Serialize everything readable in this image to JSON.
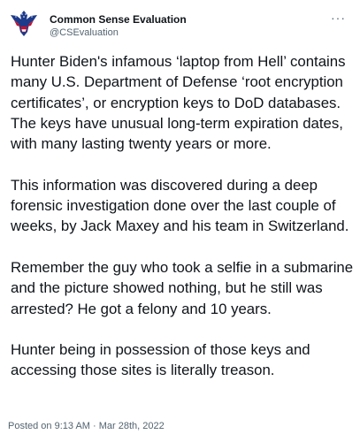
{
  "account": {
    "name": "Common Sense Evaluation",
    "handle": "@CSEvaluation",
    "avatar_icon": "eagle-flag-logo-icon",
    "more_label": "···"
  },
  "tweet": {
    "paragraphs": [
      "Hunter Biden's infamous ‘laptop from Hell’ contains\nmany U.S. Department of Defense ‘root encryption\ncertificates’, or encryption keys to DoD databases.\nThe keys have unusual long-term expiration dates,\nwith many lasting twenty years or more.",
      "This information was discovered during a deep\nforensic investigation done over the last couple of\nweeks, by Jack Maxey and his team in Switzerland.",
      "Remember the guy who took a selfie in a submarine\nand the picture showed nothing, but he still was\narrested? He got a felony and 10 years.",
      "Hunter being in possession of those keys and\naccessing those sites is literally treason."
    ]
  },
  "footer": {
    "posted": "Posted on 9:13 AM · Mar 28th, 2022"
  },
  "colors": {
    "text": "#0f1419",
    "secondary": "#536471",
    "flag_red": "#c8102e",
    "flag_blue": "#1d3b8a"
  }
}
